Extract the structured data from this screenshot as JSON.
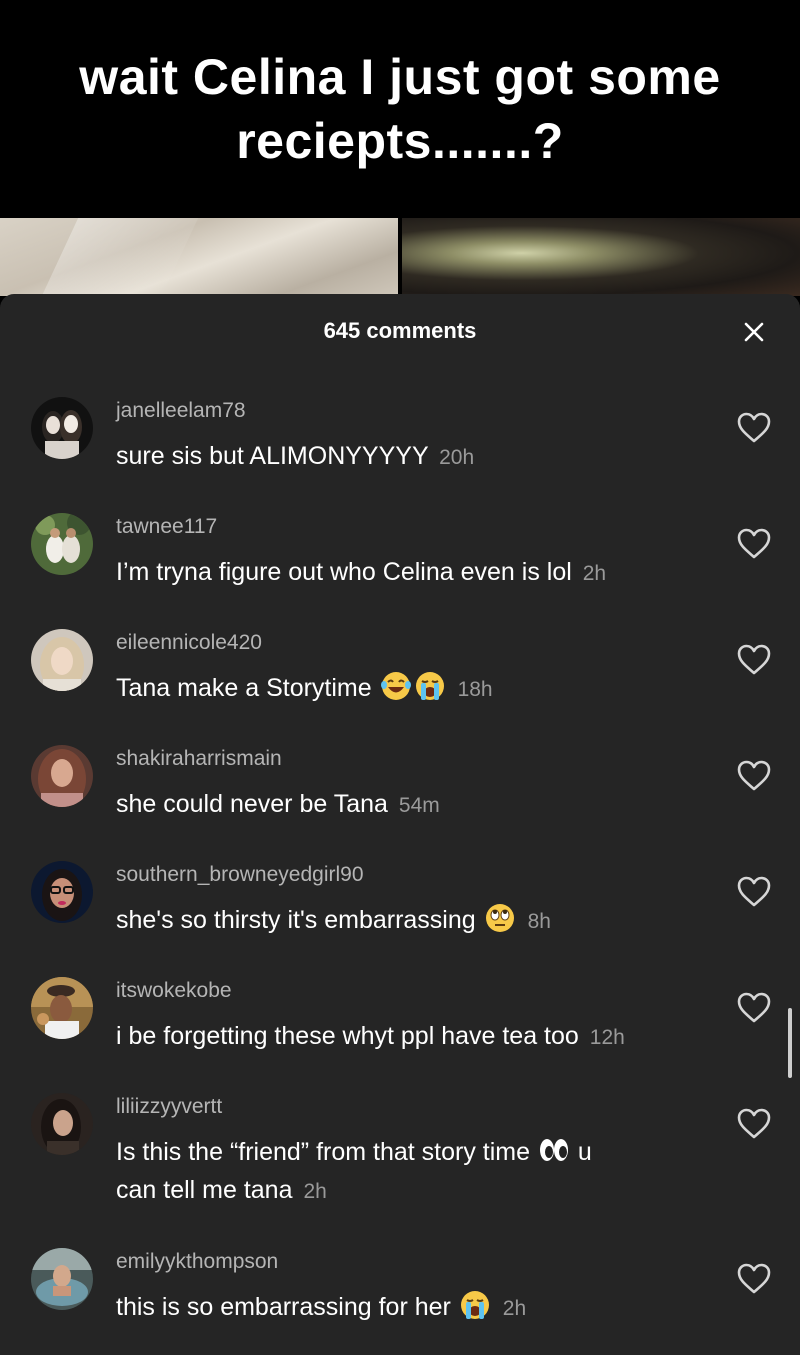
{
  "video": {
    "caption": "wait Celina I just got some reciepts.......?"
  },
  "comments_sheet": {
    "title": "645 comments",
    "close_icon": "close-icon",
    "comments": [
      {
        "username": "janelleelam78",
        "text": "sure sis but ALIMONYYYYY",
        "time": "20h"
      },
      {
        "username": "tawnee117",
        "text": "I’m tryna figure out who Celina even is lol",
        "time": "2h"
      },
      {
        "username": "eileennicole420",
        "text": "Tana make a Storytime",
        "emojis": [
          "laughing-tears-emoji",
          "crying-emoji"
        ],
        "time": "18h"
      },
      {
        "username": "shakiraharrismain",
        "text": "she could never be Tana",
        "time": "54m"
      },
      {
        "username": "southern_browneyedgirl90",
        "text": "she's so thirsty it's embarrassing",
        "emojis": [
          "eye-roll-emoji"
        ],
        "time": "8h"
      },
      {
        "username": "itswokekobe",
        "text": "i be forgetting these whyt ppl have tea too",
        "time": "12h"
      },
      {
        "username": "liliizzyyvertt",
        "text_before": "Is this the “friend” from that story time",
        "emojis": [
          "eyes-emoji"
        ],
        "text_after": "u",
        "text_line2": "can tell me tana",
        "time": "2h"
      },
      {
        "username": "emilyykthompson",
        "text": "this is so embarrassing for her",
        "emojis": [
          "crying-emoji"
        ],
        "time": "2h"
      }
    ]
  },
  "colors": {
    "sheet_background": "#252525",
    "username": "#b5b5b5",
    "timestamp": "#9a9a9a",
    "text": "#ffffff"
  }
}
